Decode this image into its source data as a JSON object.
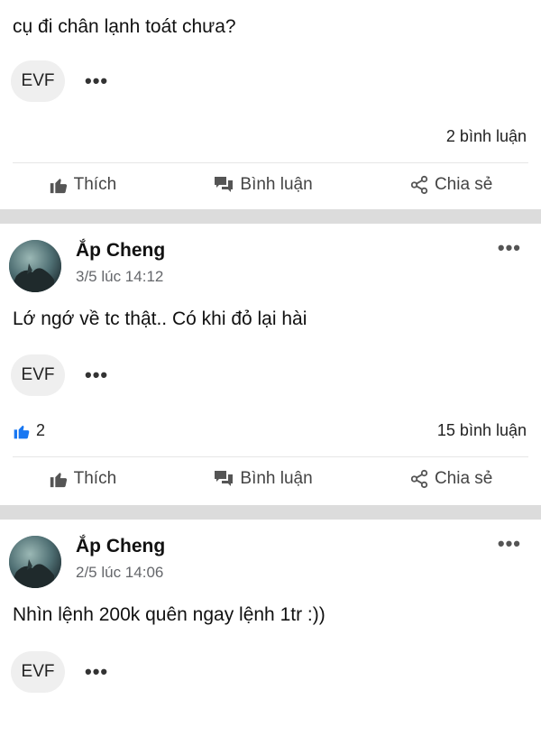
{
  "posts": [
    {
      "content": "cụ đi chân lạnh toát chưa?",
      "tag": "EVF",
      "more": "•••",
      "comments": "2 bình luận",
      "actions": {
        "like": "Thích",
        "comment": "Bình luận",
        "share": "Chia sẻ"
      }
    },
    {
      "author": "Ắp Cheng",
      "time": "3/5 lúc 14:12",
      "more": "•••",
      "content": "Lớ ngớ về tc thật.. Có khi đỏ lại hài",
      "tag": "EVF",
      "likes": "2",
      "comments": "15 bình luận",
      "actions": {
        "like": "Thích",
        "comment": "Bình luận",
        "share": "Chia sẻ"
      }
    },
    {
      "author": "Ắp Cheng",
      "time": "2/5 lúc 14:06",
      "more": "•••",
      "content": "Nhìn lệnh 200k quên ngay lệnh 1tr :))",
      "tag": "EVF"
    }
  ],
  "colors": {
    "like_blue": "#1877f2",
    "separator": "#dcdcdc",
    "tag_bg": "#efefef"
  },
  "icons": {
    "like": "thumbs-up-icon",
    "comment": "speech-bubbles-icon",
    "share": "share-icon",
    "more": "more-dots-icon"
  }
}
